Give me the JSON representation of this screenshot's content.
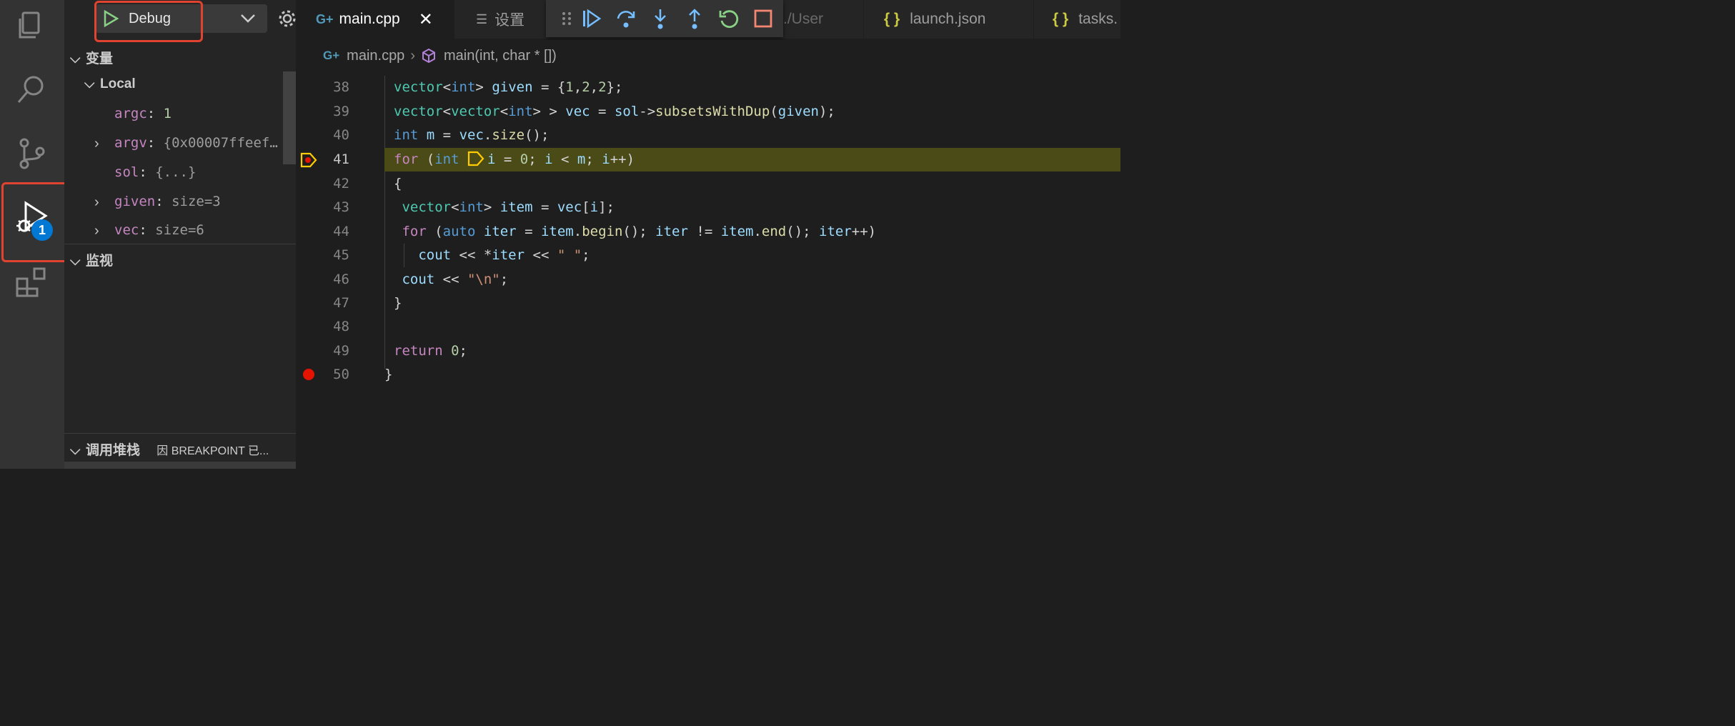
{
  "debug": {
    "config": "Debug"
  },
  "activity": {
    "debug_badge": "1"
  },
  "sidebar": {
    "variables_title": "变量",
    "local_title": "Local",
    "vars": [
      {
        "name": "argc",
        "value": "1"
      },
      {
        "name": "argv",
        "value": "{0x00007ffeef…"
      },
      {
        "name": "sol",
        "value": "{...}"
      },
      {
        "name": "given",
        "value": "size=3"
      },
      {
        "name": "vec",
        "value": "size=6"
      }
    ],
    "watch_title": "监视",
    "callstack_title": "调用堆栈",
    "callstack_status": "因 BREAKPOINT 已..."
  },
  "tabs": [
    {
      "label": "main.cpp",
      "icon": "cpp-file-icon"
    },
    {
      "label": "设置",
      "icon": "settings-list-icon"
    },
    {
      "label": "./User"
    },
    {
      "label": "launch.json",
      "icon": "json-braces-icon"
    },
    {
      "label": "tasks.",
      "icon": "json-braces-icon"
    }
  ],
  "breadcrumb": {
    "file": "main.cpp",
    "symbol": "main(int, char * [])"
  },
  "editor": {
    "current_line": 41,
    "breakpoints": [
      41,
      50
    ],
    "lines": [
      38,
      39,
      40,
      41,
      42,
      43,
      44,
      45,
      46,
      47,
      48,
      49,
      50
    ]
  },
  "colors": {
    "highlight": "#e0432f",
    "current_line_bg": "#4b4b18",
    "badge": "#0078d4",
    "breakpoint": "#e51400"
  }
}
